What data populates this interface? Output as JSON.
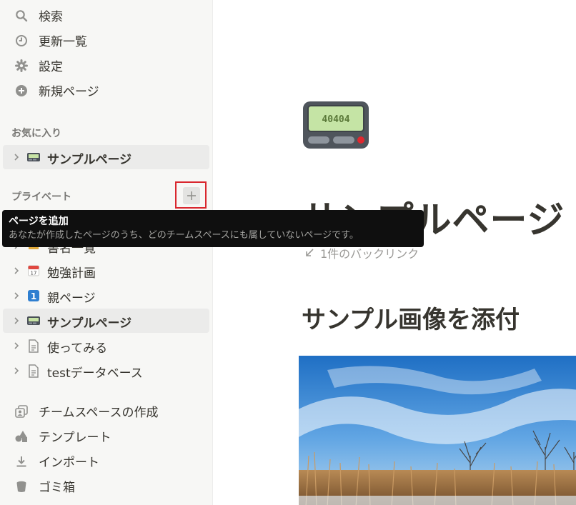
{
  "sidebar": {
    "menu": {
      "search": "検索",
      "updates": "更新一覧",
      "settings": "設定",
      "new_page": "新規ページ"
    },
    "favorites_label": "お気に入り",
    "favorites": [
      {
        "label": "サンプルページ",
        "icon": "pager-icon"
      }
    ],
    "private_label": "プライベート",
    "private_pages": [
      {
        "label": "書名一覧",
        "icon": "book-icon"
      },
      {
        "label": "勉強計画",
        "icon": "calendar-icon"
      },
      {
        "label": "親ページ",
        "icon": "keycap-one-icon"
      },
      {
        "label": "サンプルページ",
        "icon": "pager-icon"
      },
      {
        "label": "使ってみる",
        "icon": "document-icon"
      },
      {
        "label": "testデータベース",
        "icon": "document-icon"
      }
    ],
    "bottom": {
      "create_teamspace": "チームスペースの作成",
      "templates": "テンプレート",
      "import": "インポート",
      "trash": "ゴミ箱"
    }
  },
  "tooltip": {
    "title": "ページを追加",
    "description": "あなたが作成したページのうち、どのチームスペースにも属していないページです。"
  },
  "main": {
    "pager_display": "40404",
    "title": "サンプルページ",
    "backlinks": "1件のバックリンク",
    "heading": "サンプル画像を添付"
  },
  "colors": {
    "sidebar_bg": "#f7f7f5",
    "text": "#37352f",
    "highlight": "#d9272e",
    "tooltip_bg": "#0f0f0f"
  }
}
